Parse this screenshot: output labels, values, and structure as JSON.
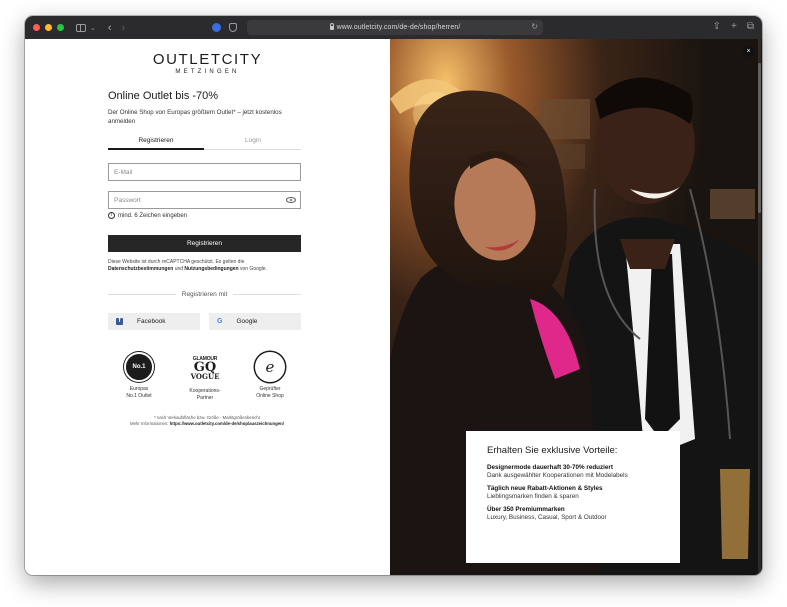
{
  "browser": {
    "url": "www.outletcity.com/de-de/shop/herren/",
    "tab_right_icons": [
      "share-icon",
      "new-tab-icon",
      "tab-overview-icon"
    ]
  },
  "logo": {
    "main": "OUTLETCITY",
    "sub": "METZINGEN"
  },
  "page": {
    "headline": "Online Outlet bis -70%",
    "subline": "Der Online Shop von Europas größtem Outlet* – jetzt kostenlos anmelden"
  },
  "tabs": [
    {
      "label": "Registrieren",
      "active": true
    },
    {
      "label": "Login",
      "active": false
    }
  ],
  "form": {
    "email_placeholder": "E-Mail",
    "password_placeholder": "Passwort",
    "password_hint": "mind. 6 Zeichen eingeben",
    "submit_label": "Registrieren"
  },
  "recaptcha": {
    "text_1": "Diese Website ist durch reCAPTCHA geschützt. Es gelten die",
    "privacy_link": "Datenschutzbestimmungen",
    "text_2": "und",
    "terms_link": "Nutzungsbedingungen",
    "text_3": "von Google."
  },
  "social": {
    "divider_label": "Registrieren mit",
    "facebook_label": "Facebook",
    "google_label": "Google"
  },
  "badges": [
    {
      "name": "europas-no1-seal",
      "seal_text": "No.1",
      "caption_line1": "Europas",
      "caption_line2": "No.1 Outlet"
    },
    {
      "name": "glamour-gq-vogue",
      "logo_1": "GLAMOUR",
      "logo_2": "GQ",
      "logo_3": "VOGUE",
      "caption_line1": "Kooperations-",
      "caption_line2": "Partner"
    },
    {
      "name": "geprueftter-online-shop-seal",
      "seal_text": "e",
      "caption_line1": "Geprüfter",
      "caption_line2": "Online Shop"
    }
  ],
  "footnote": {
    "line_1": "* nach Verkaufsfläche bzw. Größe - Marktgrößenbericht",
    "line_2_prefix": "Mehr Informationen:",
    "line_2_link": "https://www.outletcity.com/de-de/shop/auszeichnungen/"
  },
  "promo": {
    "title": "Erhalten Sie exklusive Vorteile:",
    "items": [
      {
        "title": "Designermode dauerhaft 30-70% reduziert",
        "desc": "Dank ausgewählter Kooperationen mit Modelabels"
      },
      {
        "title": "Täglich neue Rabatt-Aktionen & Styles",
        "desc": "Lieblingsmarken finden & sparen"
      },
      {
        "title": "Über 350 Premiummarken",
        "desc": "Luxury, Business, Casual, Sport & Outdoor"
      }
    ]
  },
  "colors": {
    "toolbar": "#2b2b2d",
    "button_dark": "#262626",
    "social_bg": "#eeeeee",
    "facebook": "#3b5998",
    "accent_pink": "#e0288a"
  }
}
